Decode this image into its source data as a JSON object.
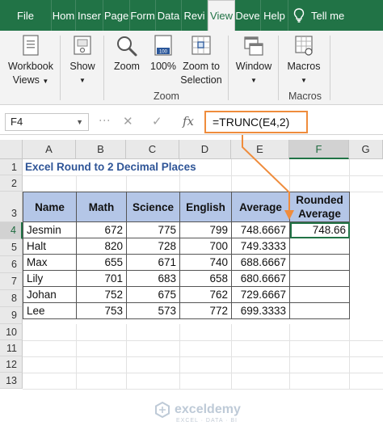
{
  "ribbon_tabs": [
    {
      "label": "File"
    },
    {
      "label": "Hom"
    },
    {
      "label": "Inser"
    },
    {
      "label": "Page"
    },
    {
      "label": "Form"
    },
    {
      "label": "Data"
    },
    {
      "label": "Revi"
    },
    {
      "label": "View",
      "active": true
    },
    {
      "label": "Deve"
    },
    {
      "label": "Help"
    }
  ],
  "tell_me": "Tell me",
  "ribbon": {
    "workbook_views_line1": "Workbook",
    "workbook_views_line2": "Views",
    "show": "Show",
    "zoom": "Zoom",
    "zoom_100": "100%",
    "zoom_to_selection_line1": "Zoom to",
    "zoom_to_selection_line2": "Selection",
    "zoom_group": "Zoom",
    "window": "Window",
    "macros": "Macros",
    "macros_group": "Macros",
    "icon_100_text": "100"
  },
  "formula_bar": {
    "name_box": "F4",
    "formula": "=TRUNC(E4,2)",
    "fx": "fx"
  },
  "columns": [
    "A",
    "B",
    "C",
    "D",
    "E",
    "F",
    "G"
  ],
  "rows": [
    "1",
    "2",
    "3",
    "4",
    "5",
    "6",
    "7",
    "8",
    "9",
    "10",
    "11",
    "12",
    "13"
  ],
  "sheet_title": "Excel Round to 2 Decimal Places",
  "table": {
    "headers": [
      "Name",
      "Math",
      "Science",
      "English",
      "Average",
      "Rounded Average"
    ],
    "rows": [
      [
        "Jesmin",
        "672",
        "775",
        "799",
        "748.6667",
        "748.66"
      ],
      [
        "Halt",
        "820",
        "728",
        "700",
        "749.3333",
        ""
      ],
      [
        "Max",
        "655",
        "671",
        "740",
        "688.6667",
        ""
      ],
      [
        "Lily",
        "701",
        "683",
        "658",
        "680.6667",
        ""
      ],
      [
        "Johan",
        "752",
        "675",
        "762",
        "729.6667",
        ""
      ],
      [
        "Lee",
        "753",
        "573",
        "772",
        "699.3333",
        ""
      ]
    ]
  },
  "watermark": {
    "name": "exceldemy",
    "tagline": "EXCEL · DATA · BI"
  },
  "colors": {
    "excel_green": "#217346",
    "header_fill": "#b4c6e7",
    "title_blue": "#2f5597",
    "callout_orange": "#ef8c3c"
  }
}
